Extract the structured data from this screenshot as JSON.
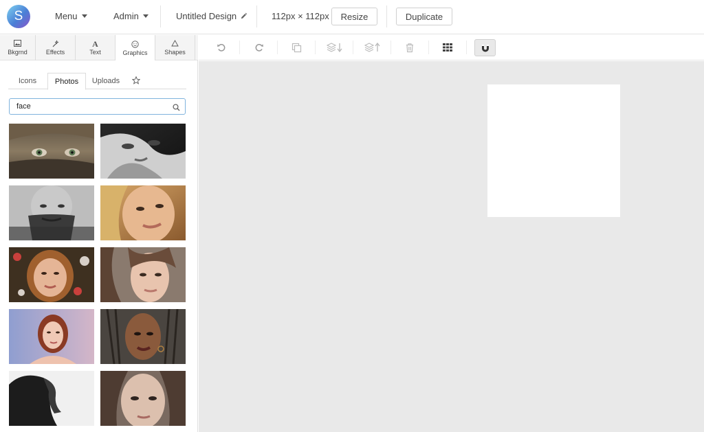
{
  "app": {
    "logo_letter": "S"
  },
  "topbar": {
    "menu_label": "Menu",
    "admin_label": "Admin",
    "design_title": "Untitled Design",
    "size_label": "112px × 112px",
    "resize_label": "Resize",
    "duplicate_label": "Duplicate"
  },
  "tabs": [
    {
      "label": "Bkgrnd",
      "icon": "image-icon"
    },
    {
      "label": "Effects",
      "icon": "magic-wand-icon"
    },
    {
      "label": "Text",
      "icon": "text-icon"
    },
    {
      "label": "Graphics",
      "icon": "smiley-icon"
    },
    {
      "label": "Shapes",
      "icon": "triangle-icon"
    }
  ],
  "active_tab": "Graphics",
  "toolbar": {
    "tools": [
      "undo-icon",
      "redo-icon",
      "copy-icon",
      "send-backward-icon",
      "bring-forward-icon",
      "trash-icon",
      "grid-icon",
      "magnet-icon"
    ]
  },
  "panel": {
    "subtabs": [
      "Icons",
      "Photos",
      "Uploads"
    ],
    "active_subtab": "Photos",
    "favorites_icon": "star-icon",
    "search_value": "face",
    "search_placeholder": "Search"
  },
  "photos": [
    "face-photo",
    "face-photo",
    "face-photo",
    "face-photo",
    "face-photo",
    "face-photo",
    "face-photo",
    "face-photo",
    "face-photo",
    "face-photo"
  ],
  "colors": {
    "canvas_bg": "#e9e9e9",
    "accent": "#7fb3dd"
  }
}
